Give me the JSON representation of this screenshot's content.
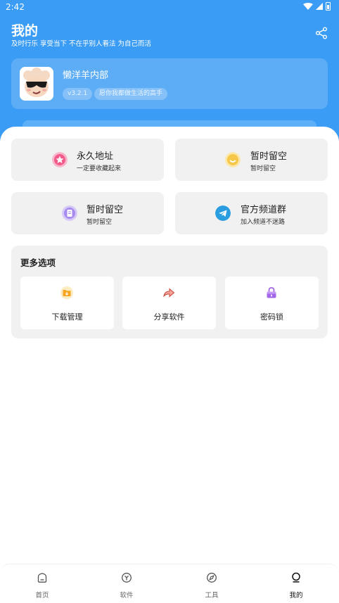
{
  "status_bar": {
    "time": "2:42"
  },
  "header": {
    "title": "我的",
    "subtitle": "及时行乐 享受当下 不在乎别人看法 为自己而活",
    "share_icon": "share-icon"
  },
  "profile": {
    "name": "懒洋羊内部",
    "version": "v3.2.1",
    "slogan": "愿你我都做生活的高手",
    "avatar_icon": "cartoon-sheep-sunglasses-avatar"
  },
  "tiles": [
    {
      "title": "永久地址",
      "subtitle": "一定要收藏起来",
      "icon": "star-icon",
      "color": "#f25a8a"
    },
    {
      "title": "暂时留空",
      "subtitle": "暂时留空",
      "icon": "smile-icon",
      "color": "#f5c84a"
    },
    {
      "title": "暂时留空",
      "subtitle": "暂时留空",
      "icon": "document-icon",
      "color": "#a78bef"
    },
    {
      "title": "官方频道群",
      "subtitle": "加入频道不迷路",
      "icon": "telegram-icon",
      "color": "#2a9de0"
    }
  ],
  "more": {
    "title": "更多选项",
    "options": [
      {
        "label": "下载管理",
        "icon": "download-folder-icon",
        "color": "#f6a623"
      },
      {
        "label": "分享软件",
        "icon": "share-arrow-icon",
        "color": "#e8685c"
      },
      {
        "label": "密码锁",
        "icon": "lock-icon",
        "color": "#a267e8"
      }
    ]
  },
  "nav": [
    {
      "label": "首页",
      "icon": "home-icon"
    },
    {
      "label": "软件",
      "icon": "apps-icon"
    },
    {
      "label": "工具",
      "icon": "compass-icon"
    },
    {
      "label": "我的",
      "icon": "profile-icon",
      "active": true
    }
  ],
  "colors": {
    "primary": "#3a9cf5",
    "tile_bg": "#f1f1f1"
  }
}
